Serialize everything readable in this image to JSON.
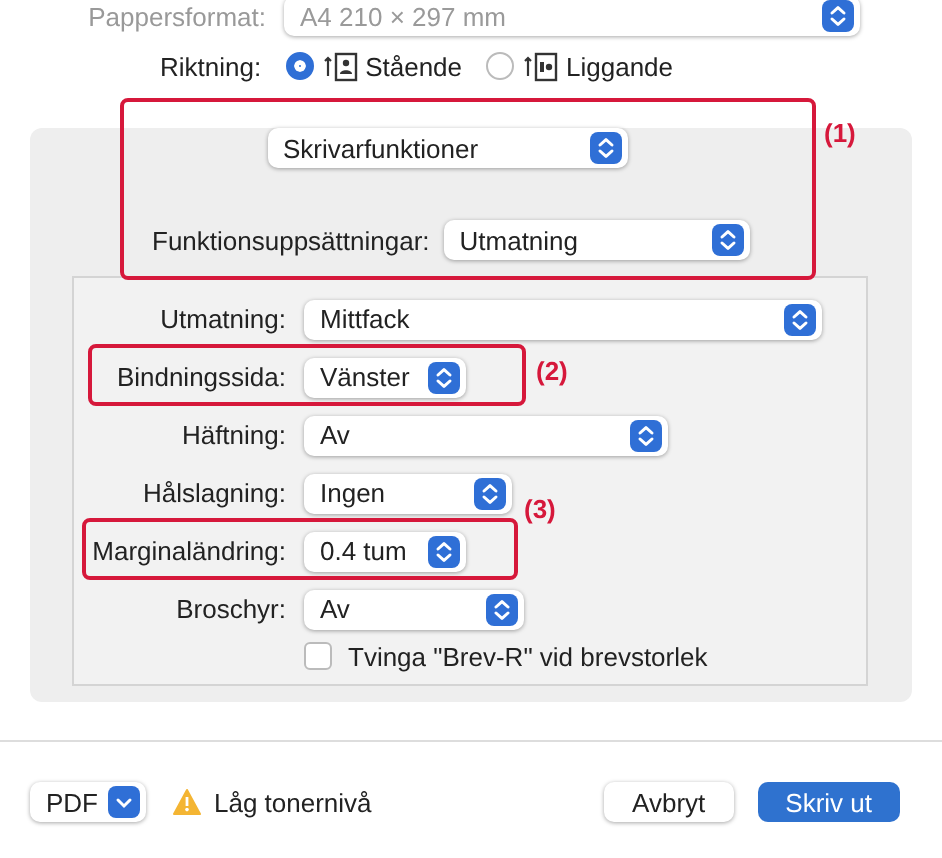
{
  "paper_size": {
    "label": "Pappersformat:",
    "value": "A4 210 × 297 mm"
  },
  "orientation": {
    "label": "Riktning:",
    "options": [
      {
        "label": "Stående",
        "kind": "portrait",
        "selected": true
      },
      {
        "label": "Liggande",
        "kind": "landscape",
        "selected": false
      }
    ]
  },
  "settings_group": {
    "callout": "(1)",
    "panel": "Skrivarfunktioner",
    "feature_set": {
      "label": "Funktionsuppsättningar:",
      "value": "Utmatning"
    }
  },
  "settings": [
    {
      "label": "Utmatning:",
      "value": "Mittfack"
    },
    {
      "label": "Bindningssida:",
      "value": "Vänster",
      "callout": "(2)"
    },
    {
      "label": "Häftning:",
      "value": "Av"
    },
    {
      "label": "Hålslagning:",
      "value": "Ingen"
    },
    {
      "label": "Marginaländring:",
      "value": "0.4 tum",
      "callout": "(3)"
    },
    {
      "label": "Broschyr:",
      "value": "Av"
    }
  ],
  "force_letter": {
    "label": "Tvinga \"Brev-R\" vid brevstorlek",
    "checked": false
  },
  "footer": {
    "pdf": "PDF",
    "warning": "Låg tonernivå",
    "buttons": [
      {
        "label": "Avbryt",
        "kind": "secondary"
      },
      {
        "label": "Skriv ut",
        "kind": "primary"
      }
    ]
  }
}
